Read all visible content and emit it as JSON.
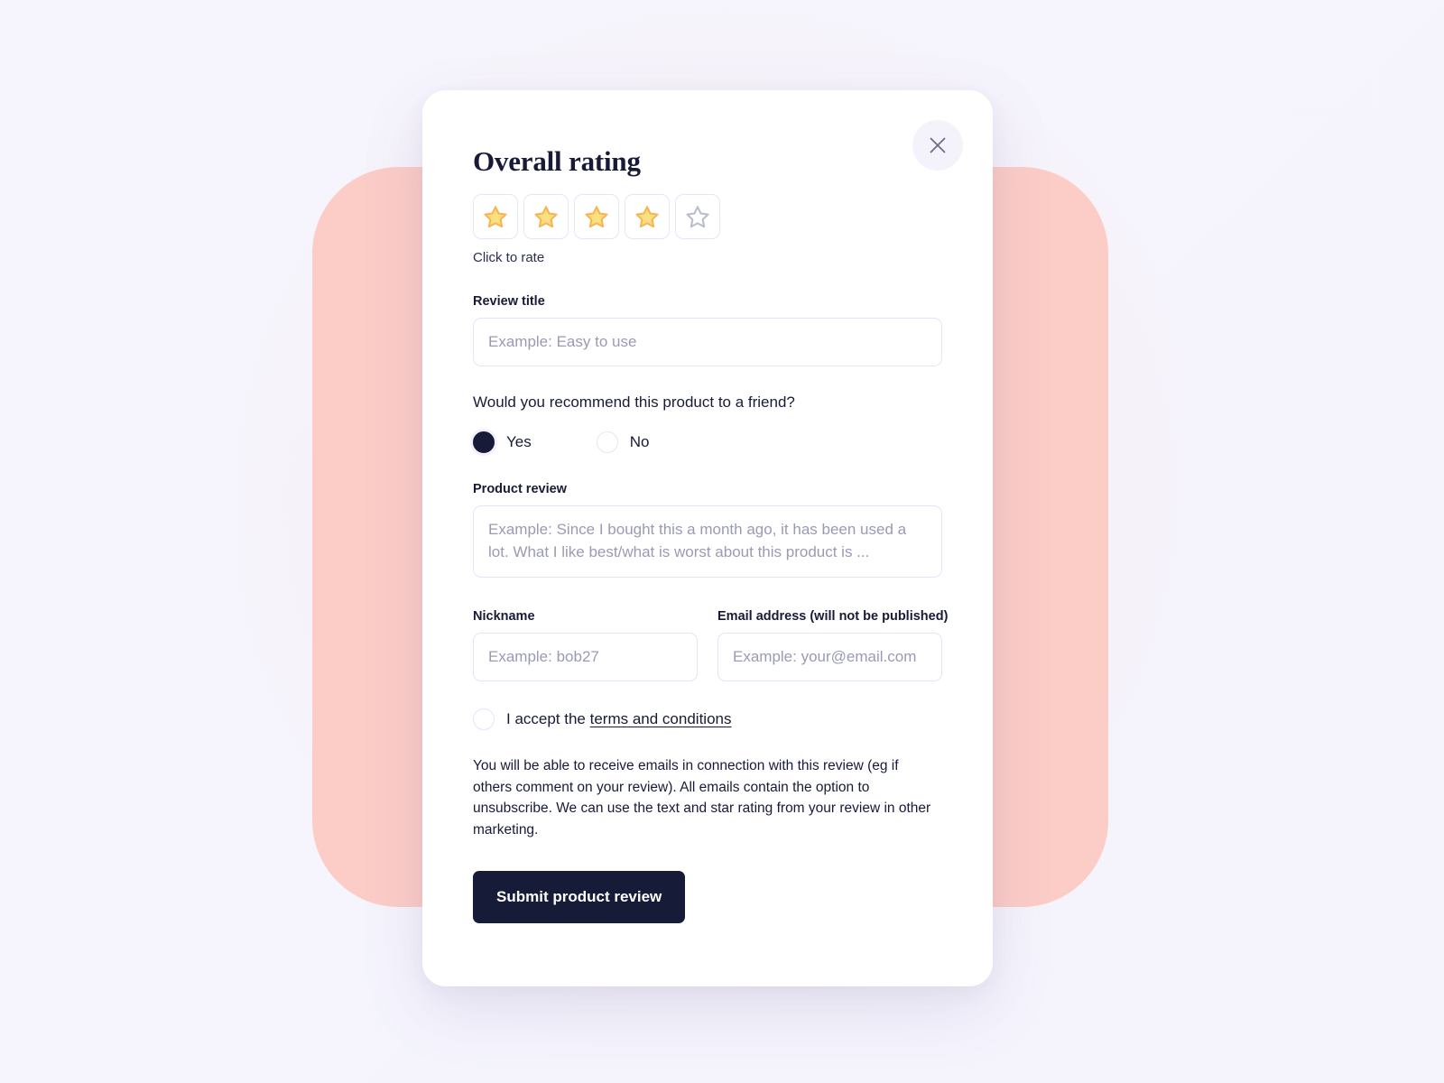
{
  "colors": {
    "page_background": "#f5f4fd",
    "decorative_block": "#fccdc7",
    "card_background": "#ffffff",
    "text_primary": "#181b37",
    "placeholder": "#9a9ab4",
    "border": "#e6e5f8",
    "star_fill": "#fbdf80",
    "star_stroke": "#f9b450",
    "star_empty_stroke": "#b9bcc9",
    "submit_background": "#161b38",
    "close_background": "#f4f3fc",
    "close_icon": "#6b6e84"
  },
  "modal": {
    "close_button": {
      "icon": "close-icon",
      "label": "Close"
    },
    "title": "Overall rating",
    "rating": {
      "icon_filled": "star-filled-icon",
      "icon_empty": "star-outline-icon",
      "total_stars": 5,
      "selected": 4,
      "hint": "Click to rate"
    },
    "review_title": {
      "label": "Review title",
      "placeholder": "Example: Easy to use",
      "value": ""
    },
    "recommend": {
      "question": "Would you recommend this product to a friend?",
      "selected": "Yes",
      "options": [
        {
          "label": "Yes",
          "selected": true
        },
        {
          "label": "No",
          "selected": false
        }
      ]
    },
    "product_review": {
      "label": "Product review",
      "placeholder": "Example: Since I bought this a month ago, it has been used a lot. What I like best/what is worst about this product is ...",
      "value": ""
    },
    "nickname": {
      "label": "Nickname",
      "placeholder": "Example: bob27",
      "value": ""
    },
    "email": {
      "label": "Email address (will not be published)",
      "placeholder": "Example: your@email.com",
      "value": ""
    },
    "terms": {
      "checked": false,
      "text_prefix": "I accept the ",
      "link_text": "terms and conditions"
    },
    "legal_text": "You will be able to receive emails in connection with this review (eg if others comment on your review). All emails contain the option to unsubscribe. We can use the text and star rating from your review in other marketing.",
    "submit_label": "Submit product review"
  }
}
